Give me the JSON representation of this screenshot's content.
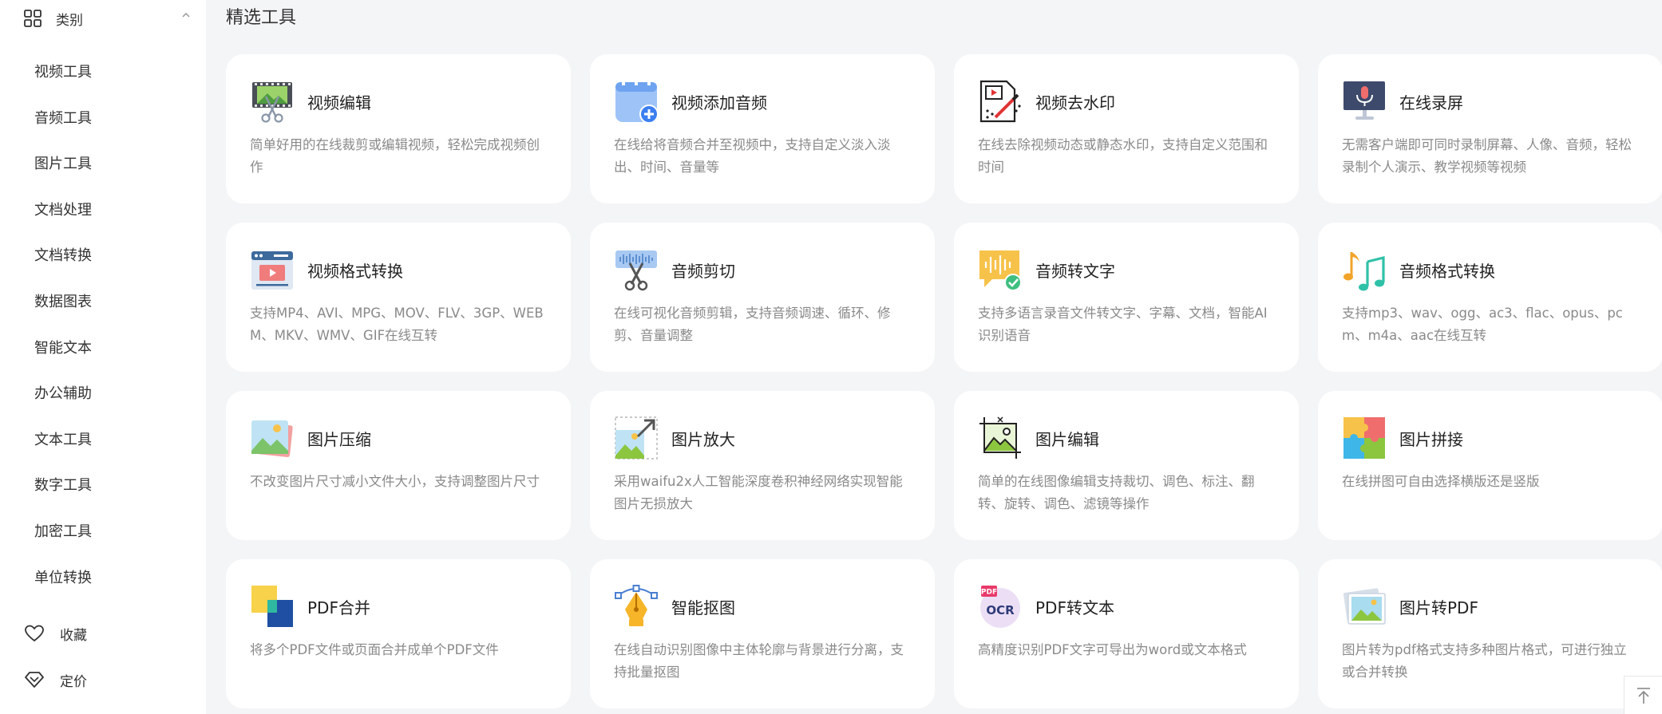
{
  "sidebar": {
    "category_label": "类别",
    "items": [
      {
        "label": "视频工具"
      },
      {
        "label": "音频工具"
      },
      {
        "label": "图片工具"
      },
      {
        "label": "文档处理"
      },
      {
        "label": "文档转换"
      },
      {
        "label": "数据图表"
      },
      {
        "label": "智能文本"
      },
      {
        "label": "办公辅助"
      },
      {
        "label": "文本工具"
      },
      {
        "label": "数字工具"
      },
      {
        "label": "加密工具"
      },
      {
        "label": "单位转换"
      }
    ],
    "favorites_label": "收藏",
    "pricing_label": "定价"
  },
  "main": {
    "section_title": "精选工具",
    "tools": [
      {
        "title": "视频编辑",
        "desc": "简单好用的在线裁剪或编辑视频，轻松完成视频创作",
        "icon": "video-edit-icon"
      },
      {
        "title": "视频添加音频",
        "desc": "在线给将音频合并至视频中，支持自定义淡入淡出、时间、音量等",
        "icon": "video-add-audio-icon"
      },
      {
        "title": "视频去水印",
        "desc": "在线去除视频动态或静态水印，支持自定义范围和时间",
        "icon": "video-watermark-icon"
      },
      {
        "title": "在线录屏",
        "desc": "无需客户端即可同时录制屏幕、人像、音频，轻松录制个人演示、教学视频等视频",
        "icon": "screen-record-icon"
      },
      {
        "title": "视频格式转换",
        "desc": "支持MP4、AVI、MPG、MOV、FLV、3GP、WEBM、MKV、WMV、GIF在线互转",
        "icon": "video-convert-icon"
      },
      {
        "title": "音频剪切",
        "desc": "在线可视化音频剪辑，支持音频调速、循环、修剪、音量调整",
        "icon": "audio-cut-icon"
      },
      {
        "title": "音频转文字",
        "desc": "支持多语言录音文件转文字、字幕、文档，智能AI识别语音",
        "icon": "audio-to-text-icon"
      },
      {
        "title": "音频格式转换",
        "desc": "支持mp3、wav、ogg、ac3、flac、opus、pcm、m4a、aac在线互转",
        "icon": "audio-convert-icon"
      },
      {
        "title": "图片压缩",
        "desc": "不改变图片尺寸减小文件大小，支持调整图片尺寸",
        "icon": "image-compress-icon"
      },
      {
        "title": "图片放大",
        "desc": "采用waifu2x人工智能深度卷积神经网络实现智能图片无损放大",
        "icon": "image-enlarge-icon"
      },
      {
        "title": "图片编辑",
        "desc": "简单的在线图像编辑支持裁切、调色、标注、翻转、旋转、调色、滤镜等操作",
        "icon": "image-edit-icon"
      },
      {
        "title": "图片拼接",
        "desc": "在线拼图可自由选择横版还是竖版",
        "icon": "image-puzzle-icon"
      },
      {
        "title": "PDF合并",
        "desc": "将多个PDF文件或页面合并成单个PDF文件",
        "icon": "pdf-merge-icon"
      },
      {
        "title": "智能抠图",
        "desc": "在线自动识别图像中主体轮廓与背景进行分离，支持批量抠图",
        "icon": "smart-cutout-icon"
      },
      {
        "title": "PDF转文本",
        "desc": "高精度识别PDF文字可导出为word或文本格式",
        "icon": "pdf-to-text-icon"
      },
      {
        "title": "图片转PDF",
        "desc": "图片转为pdf格式支持多种图片格式，可进行独立或合并转换",
        "icon": "image-to-pdf-icon"
      }
    ]
  },
  "icon_texts": {
    "pdf_badge": "PDF",
    "ocr_badge": "OCR"
  }
}
